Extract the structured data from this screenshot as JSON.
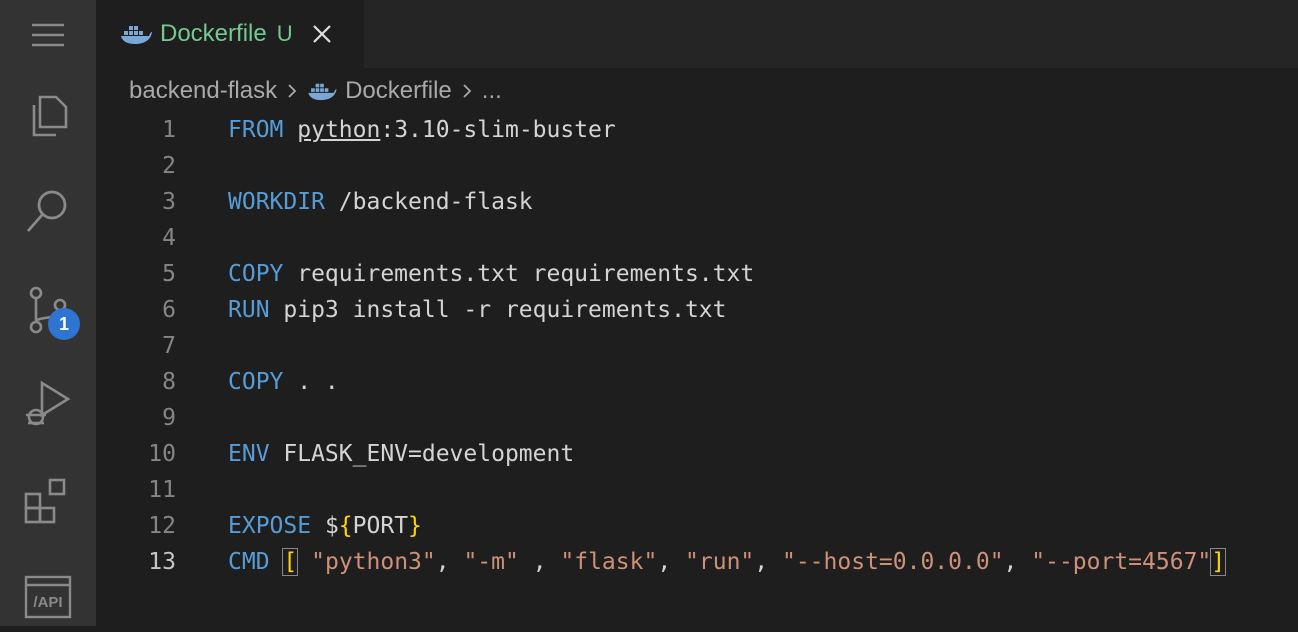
{
  "activity_bar": {
    "items": [
      {
        "name": "menu-icon"
      },
      {
        "name": "explorer-icon"
      },
      {
        "name": "search-icon"
      },
      {
        "name": "source-control-icon"
      },
      {
        "name": "run-debug-icon"
      },
      {
        "name": "extensions-icon"
      },
      {
        "name": "api-icon",
        "label": "/API"
      }
    ],
    "scm_badge": "1"
  },
  "tab": {
    "title": "Dockerfile",
    "status": "U",
    "icon": "docker-icon"
  },
  "breadcrumb": {
    "folder": "backend-flask",
    "file": "Dockerfile",
    "ellipsis": "..."
  },
  "editor": {
    "line_numbers": [
      "1",
      "2",
      "3",
      "4",
      "5",
      "6",
      "7",
      "8",
      "9",
      "10",
      "11",
      "12",
      "13"
    ],
    "active_line": 13,
    "lines": {
      "l1": {
        "kw": "FROM",
        "img": "python",
        "rest": ":3.10-slim-buster"
      },
      "l3": {
        "kw": "WORKDIR",
        "rest": " /backend-flask"
      },
      "l5": {
        "kw": "COPY",
        "rest": " requirements.txt requirements.txt"
      },
      "l6": {
        "kw": "RUN",
        "rest": " pip3 install -r requirements.txt"
      },
      "l8": {
        "kw": "COPY",
        "rest": " . ."
      },
      "l10": {
        "kw": "ENV",
        "rest": " FLASK_ENV=development"
      },
      "l12": {
        "kw": "EXPOSE",
        "dollar": " $",
        "open": "{",
        "var": "PORT",
        "close": "}"
      },
      "l13": {
        "kw": "CMD",
        "open": "[",
        "s1": "\"python3\"",
        "sep1": ", ",
        "s2": "\"-m\"",
        "sep2": " , ",
        "s3": "\"flask\"",
        "sep3": ", ",
        "s4": "\"run\"",
        "sep4": ", ",
        "s5": "\"--host=0.0.0.0\"",
        "sep5": ", ",
        "s6": "\"--port=4567\"",
        "close": "]"
      }
    }
  },
  "colors": {
    "keyword": "#569cd6",
    "string": "#ce9178",
    "untracked": "#73c991",
    "badge": "#2f74d0"
  }
}
